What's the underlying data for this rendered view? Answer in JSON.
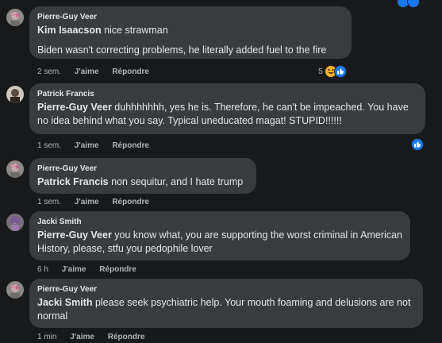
{
  "comments": [
    {
      "author": "Pierre-Guy Veer",
      "mention": "Kim Isaacson",
      "text": " nice strawman",
      "text2": "Biden wasn't correcting problems, he literally added fuel to the fire",
      "time": "2 sem.",
      "like": "J'aime",
      "reply": "Répondre",
      "reaction_count": "5"
    },
    {
      "author": "Patrick Francis",
      "mention": "Pierre-Guy Veer",
      "text": " duhhhhhhh, yes he is. Therefore, he can't be impeached. You have no idea behind what you say. Typical uneducated magat! STUPID!!!!!!",
      "time": "1 sem.",
      "like": "J'aime",
      "reply": "Répondre"
    },
    {
      "author": "Pierre-Guy Veer",
      "mention": "Patrick Francis",
      "text": " non sequitur, and I hate trump",
      "time": "1 sem.",
      "like": "J'aime",
      "reply": "Répondre"
    },
    {
      "author": "Jacki Smith",
      "mention": "Pierre-Guy Veer",
      "text": " you know what, you are supporting the worst criminal in American History, please, stfu you pedophile lover",
      "time": "6 h",
      "like": "J'aime",
      "reply": "Répondre"
    },
    {
      "author": "Pierre-Guy Veer",
      "mention": "Jacki Smith",
      "text": " please seek psychiatric help. Your mouth foaming and delusions are not normal",
      "time": "1 min",
      "like": "J'aime",
      "reply": "Répondre"
    }
  ],
  "colors": {
    "background": "#18191a",
    "bubble": "#3a3b3c",
    "like_blue": "#1877f2",
    "haha_yellow": "#f7b125"
  },
  "icons": [
    "like-reaction-icon",
    "haha-reaction-icon"
  ]
}
